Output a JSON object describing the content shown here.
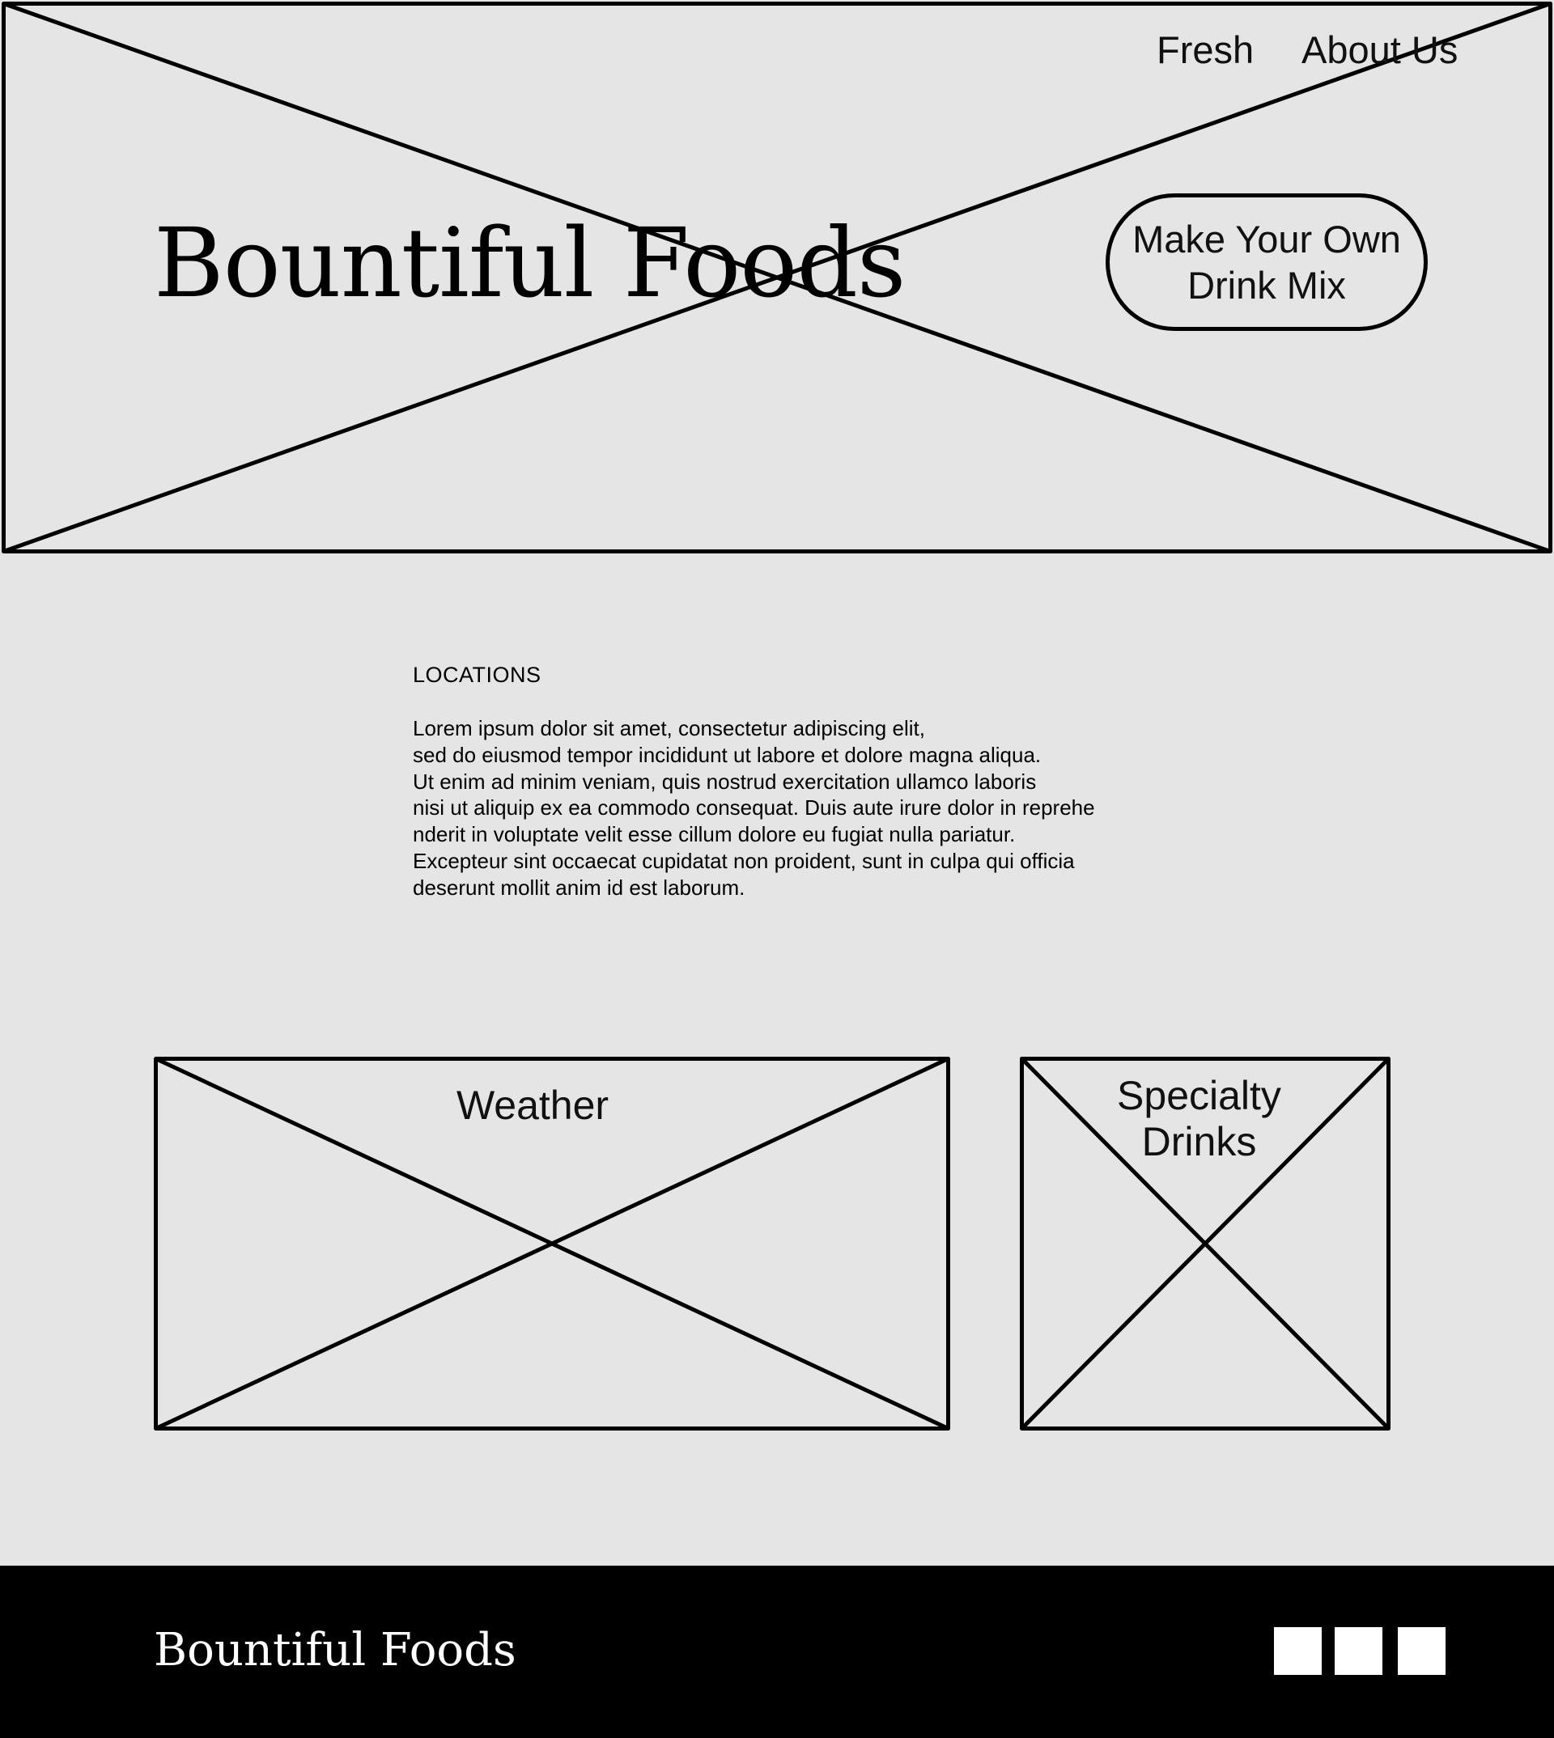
{
  "nav": {
    "fresh": "Fresh",
    "about": "About Us"
  },
  "hero": {
    "title": "Bountiful Foods",
    "cta_line1": "Make Your Own",
    "cta_line2": "Drink Mix"
  },
  "locations": {
    "heading": "LOCATIONS",
    "body_lines": [
      "Lorem ipsum dolor sit amet, consectetur adipiscing elit,",
      "sed do eiusmod tempor incididunt ut labore et dolore magna aliqua.",
      "Ut enim ad minim veniam, quis nostrud exercitation ullamco laboris",
      "nisi ut aliquip ex ea commodo consequat. Duis aute irure dolor in reprehe",
      "nderit in voluptate velit esse cillum dolore eu fugiat nulla pariatur.",
      "Excepteur sint occaecat cupidatat non proident, sunt in culpa qui officia",
      "deserunt mollit anim id est laborum."
    ]
  },
  "cards": {
    "weather_label": "Weather",
    "specialty_line1": "Specialty",
    "specialty_line2": "Drinks"
  },
  "footer": {
    "brand": "Bountiful Foods",
    "social_icons": [
      "social-icon-1",
      "social-icon-2",
      "social-icon-3"
    ]
  },
  "colors": {
    "background": "#e5e5e5",
    "stroke": "#000000",
    "footer_background": "#000000",
    "footer_text": "#ffffff"
  }
}
